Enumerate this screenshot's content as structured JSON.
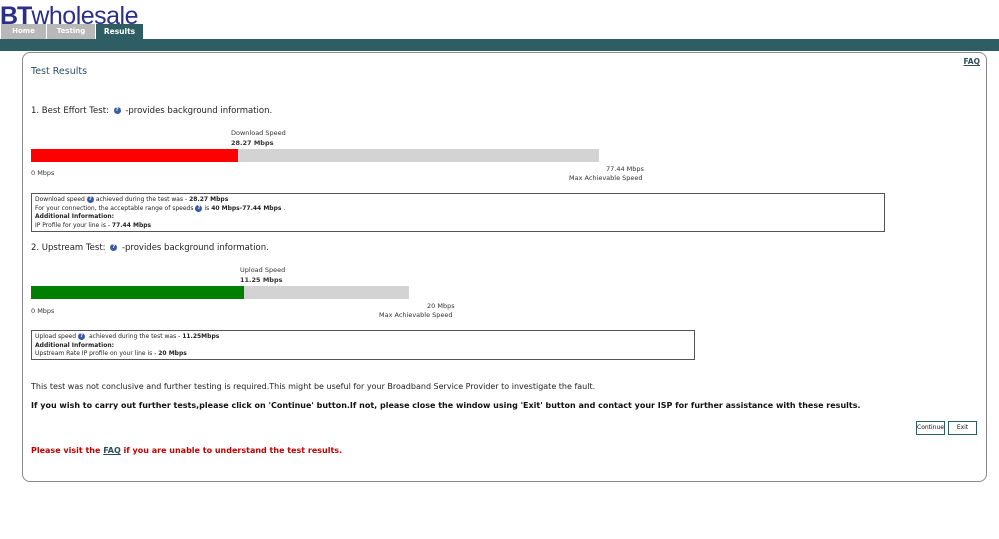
{
  "brand": {
    "bt": "BT",
    "wholesale": "wholesale"
  },
  "tabs": [
    "Home",
    "Testing",
    "Results"
  ],
  "page_title": "Test Results",
  "faq_link": "FAQ",
  "download": {
    "heading_prefix": "1. Best Effort Test:",
    "heading_suffix": "-provides background information.",
    "speed_label": "Download Speed",
    "speed_value": "28.27 Mbps",
    "min_label": "0 Mbps",
    "max_value": "77.44 Mbps",
    "max_label": "Max Achievable Speed",
    "fill_fraction": 0.365,
    "fill_color": "#ff0000",
    "info": {
      "line1_text": "Download speed",
      "line1_text2": "achieved during the test was - ",
      "line1_value": "28.27 Mbps",
      "line2_text": "For your connection, the acceptable range of speeds",
      "line2_text2": "is ",
      "line2_value": "40 Mbps-77.44 Mbps",
      "line2_end": " .",
      "line3": "Additional Information:",
      "line4_text": "IP Profile for your line is - ",
      "line4_value": "77.44 Mbps"
    }
  },
  "upload": {
    "heading_prefix": "2. Upstream Test:",
    "heading_suffix": "-provides background information.",
    "speed_label": "Upload Speed",
    "speed_value": "11.25 Mbps",
    "min_label": "0 Mbps",
    "max_value": "20 Mbps",
    "max_label": "Max Achievable Speed",
    "fill_fraction": 0.5625,
    "fill_color": "#008000",
    "info": {
      "line1_text": "Upload speed",
      "line1_text2": " achieved during the test was - ",
      "line1_value": "11.25Mbps",
      "line2": "Additional Information:",
      "line3_text": "Upstream Rate IP profile on your line is - ",
      "line3_value": "20 Mbps"
    }
  },
  "notes": {
    "not_conclusive": "This test was not conclusive and further testing is required.This might be useful for your Broadband Service Provider to investigate the fault.",
    "further_tests": "If you wish to carry out further tests,please click on 'Continue' button.If not, please close the window using 'Exit' button and contact your ISP for further assistance with these results."
  },
  "buttons": {
    "continue": "Continue",
    "exit": "Exit"
  },
  "visit": {
    "prefix": "Please visit the ",
    "link": "FAQ",
    "suffix": " if you are unable to understand the test results."
  }
}
